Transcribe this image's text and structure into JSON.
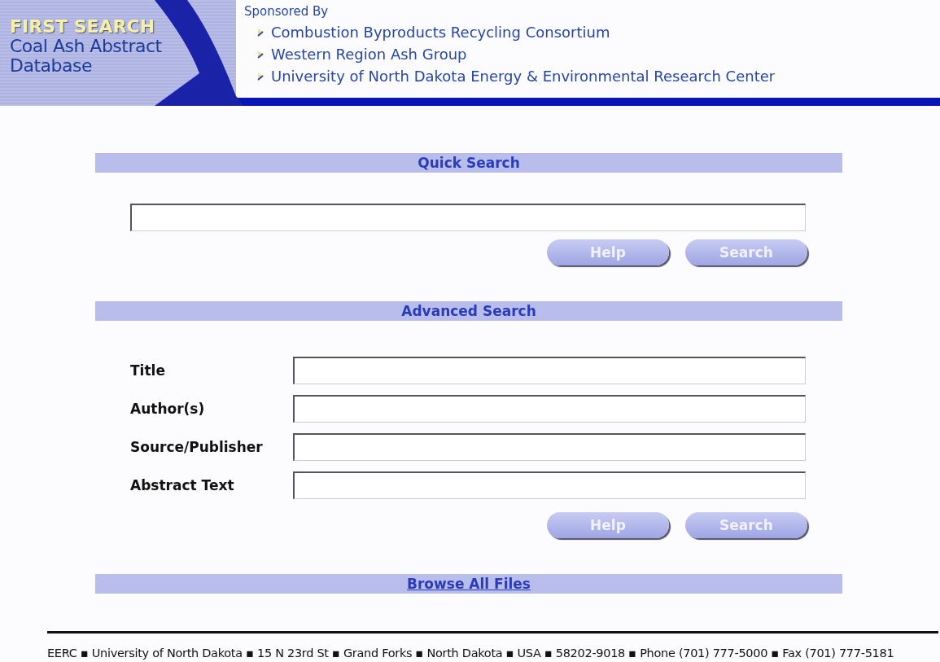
{
  "header": {
    "brand": "FIRST SEARCH",
    "subtitle": "Coal Ash Abstract Database",
    "sponsored_label": "Sponsored By",
    "sponsors": [
      "Combustion Byproducts Recycling Consortium",
      "Western Region Ash Group",
      "University of North Dakota Energy & Environmental Research Center"
    ]
  },
  "quick_search": {
    "heading": "Quick Search",
    "buttons": [
      "Help",
      "Search"
    ]
  },
  "advanced_search": {
    "heading": "Advanced Search",
    "fields": [
      {
        "label": "Title"
      },
      {
        "label": "Author(s)"
      },
      {
        "label": "Source/Publisher"
      },
      {
        "label": "Abstract Text"
      }
    ],
    "buttons": [
      "Help",
      "Search"
    ]
  },
  "browse_link": "Browse All Files",
  "footer": "EERC ▪ University of North Dakota ▪ 15 N 23rd St ▪ Grand Forks ▪ North Dakota ▪ USA ▪ 58202-9018 ▪ Phone (701) 777-5000 ▪ Fax (701) 777-5181"
}
